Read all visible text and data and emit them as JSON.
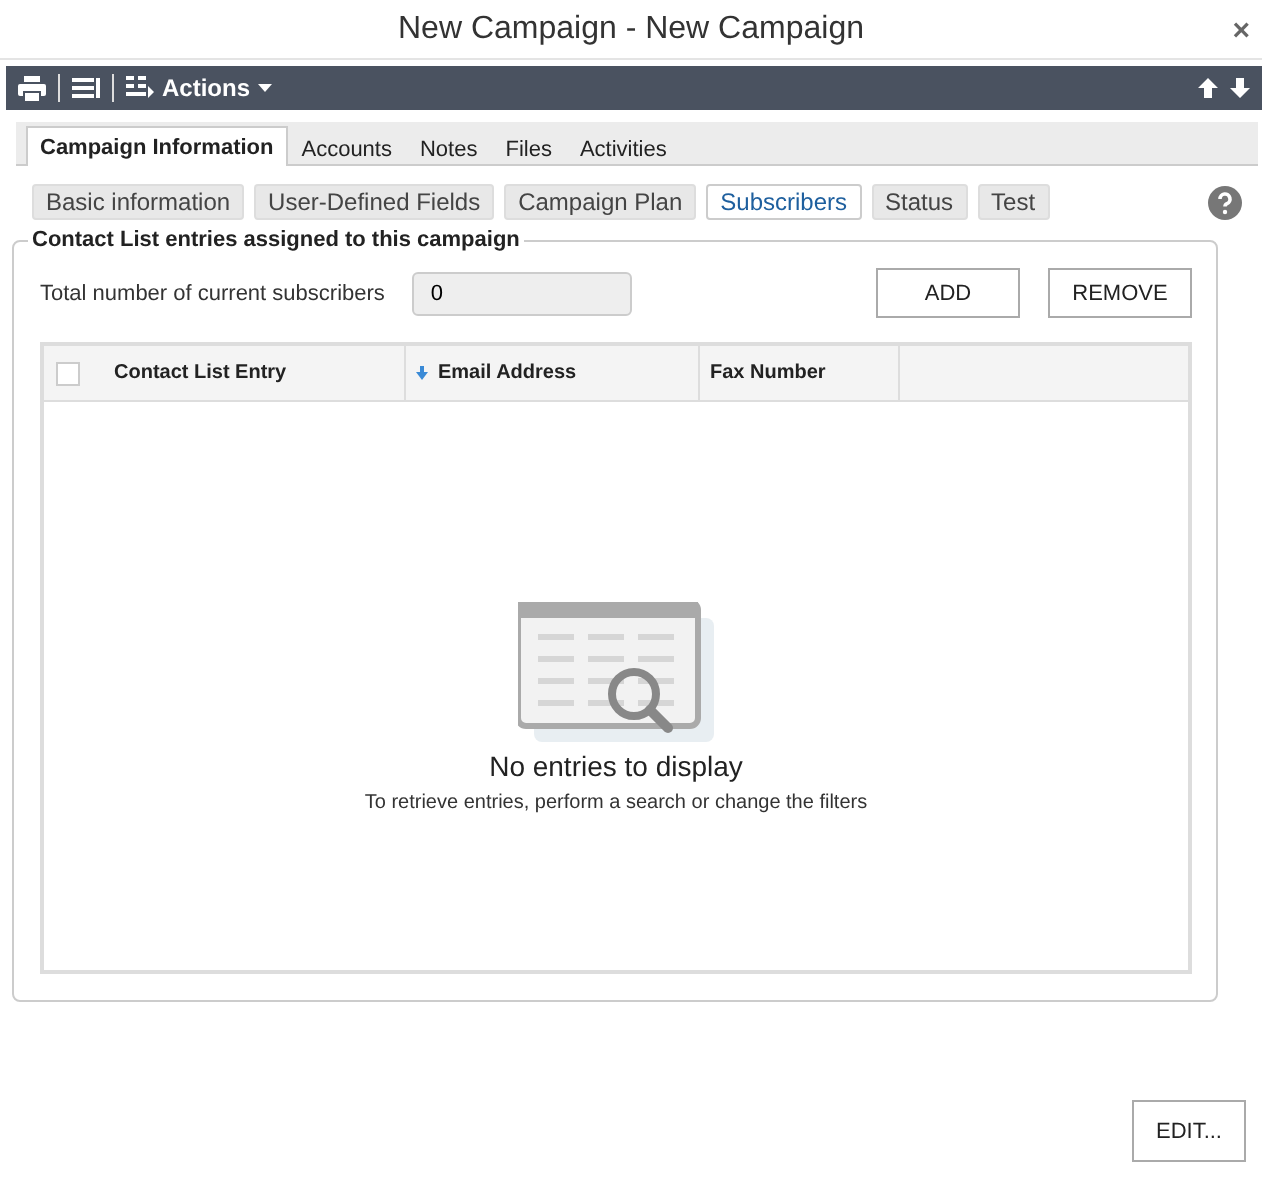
{
  "window": {
    "title": "New Campaign - New Campaign",
    "close": "×"
  },
  "toolbar": {
    "actions": "Actions"
  },
  "tabs": [
    {
      "label": "Campaign Information",
      "selected": true
    },
    {
      "label": "Accounts",
      "selected": false
    },
    {
      "label": "Notes",
      "selected": false
    },
    {
      "label": "Files",
      "selected": false
    },
    {
      "label": "Activities",
      "selected": false
    }
  ],
  "subtabs": [
    {
      "label": "Basic information",
      "selected": false
    },
    {
      "label": "User-Defined Fields",
      "selected": false
    },
    {
      "label": "Campaign Plan",
      "selected": false
    },
    {
      "label": "Subscribers",
      "selected": true
    },
    {
      "label": "Status",
      "selected": false
    },
    {
      "label": "Test",
      "selected": false
    }
  ],
  "group": {
    "legend": "Contact List entries assigned to this campaign",
    "total_label": "Total number of current subscribers",
    "total_value": "0",
    "buttons": [
      "ADD",
      "REMOVE"
    ]
  },
  "table": {
    "select_all_checked": false,
    "columns": [
      {
        "label": "Contact List Entry",
        "sorted": false
      },
      {
        "label": "Email Address",
        "sorted": true
      },
      {
        "label": "Fax Number",
        "sorted": false
      }
    ],
    "empty_title": "No entries to display",
    "empty_hint": "To retrieve entries, perform a search or change the filters"
  },
  "footer": {
    "button": "EDIT..."
  }
}
